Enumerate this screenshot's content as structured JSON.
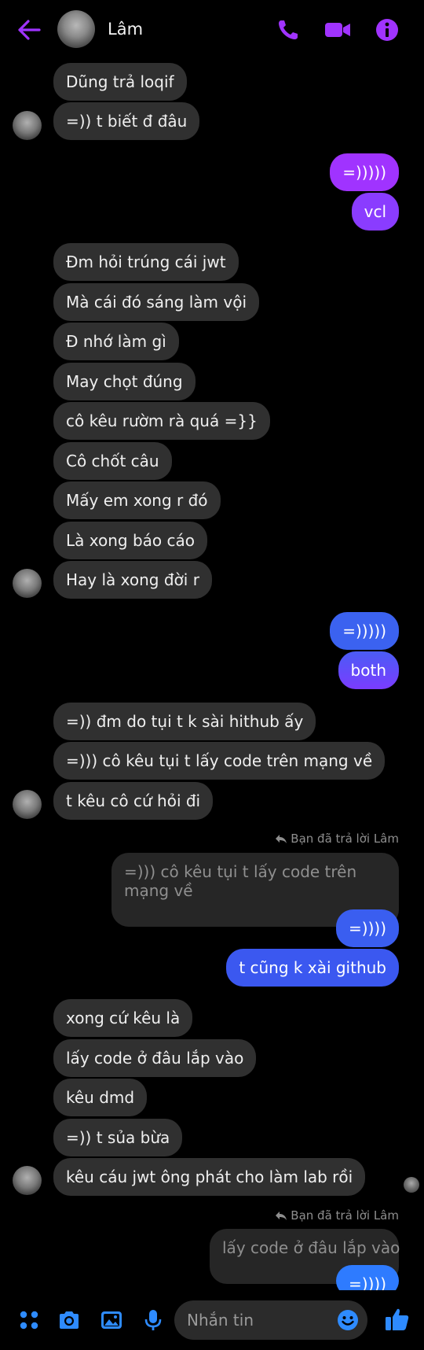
{
  "header": {
    "contact_name": "Lâm"
  },
  "colors": {
    "purple": "#a033ff",
    "blue": "#2e7bff",
    "incoming": "#303030"
  },
  "messages": {
    "m1": "Dũng trả loqif",
    "m2": "=)) t biết đ đâu",
    "m3": "=)))))",
    "m4": "vcl",
    "m5": "Đm hỏi trúng cái jwt",
    "m6": "Mà cái đó sáng làm vội",
    "m7": "Đ nhớ làm gì",
    "m8": "May chọt đúng",
    "m9": "cô kêu rườm rà quá =}}",
    "m10": "Cô chốt câu",
    "m11": "Mấy em xong r đó",
    "m12": "Là xong báo cáo",
    "m13": "Hay là xong đời r",
    "m14": "=)))))",
    "m15": "both",
    "m16": "=)) đm do tụi t k sài hithub ấy",
    "m17": "=))) cô kêu tụi t lấy code trên mạng về",
    "m18": "t kêu cô cứ hỏi đi",
    "reply1_note": "Bạn đã trả lời Lâm",
    "reply1_quote": "=))) cô kêu tụi t lấy code trên mạng về",
    "m19": "=))))",
    "m20": "t cũng k xài github",
    "m21": "xong cứ kêu là",
    "m22": "lấy code ở đâu lắp vào",
    "m23": "kêu dmd",
    "m24": "=)) t sủa bừa",
    "m25": "kêu cáu jwt ông phát cho làm lab rồi",
    "reply2_note": "Bạn đã trả lời Lâm",
    "reply2_quote": "lấy code ở đâu lắp vào",
    "m26": "=))))"
  },
  "composer": {
    "placeholder": "Nhắn tin"
  },
  "icons": [
    "back-arrow-icon",
    "phone-icon",
    "video-icon",
    "info-icon",
    "menu-dots-icon",
    "camera-icon",
    "gallery-icon",
    "microphone-icon",
    "emoji-icon",
    "like-icon",
    "reply-arrow-icon"
  ]
}
